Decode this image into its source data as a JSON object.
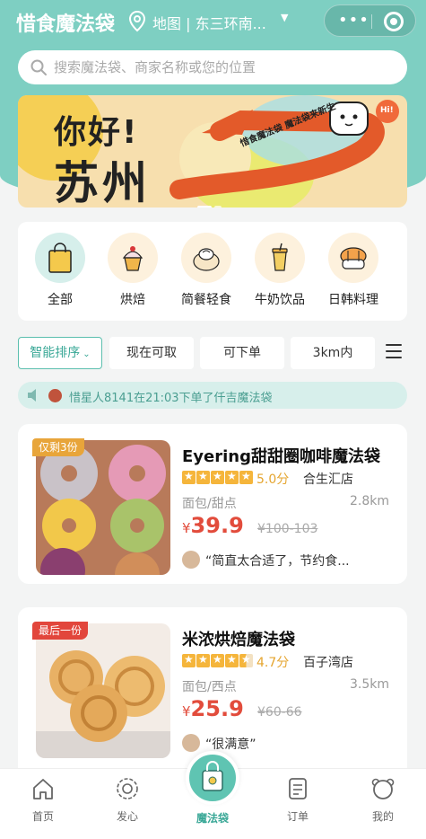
{
  "header": {
    "app_title": "惜食魔法袋",
    "location": "地图 | 东三环南...",
    "location_caret": "▼",
    "capsule_dots": "•••"
  },
  "search": {
    "placeholder": "搜索魔法袋、商家名称或您的位置"
  },
  "banner": {
    "hello": "你好!",
    "city": "苏州",
    "slogan": "惜食魔法袋  魔法袋来新生",
    "badge": "Hi!"
  },
  "categories": [
    {
      "label": "全部",
      "icon": "shopping-bag-icon"
    },
    {
      "label": "烘焙",
      "icon": "cupcake-icon"
    },
    {
      "label": "简餐轻食",
      "icon": "dumpling-icon"
    },
    {
      "label": "牛奶饮品",
      "icon": "drink-cup-icon"
    },
    {
      "label": "日韩料理",
      "icon": "sushi-icon"
    }
  ],
  "filters": {
    "sort": "智能排序",
    "sort_caret": "⌄",
    "available_now": "现在可取",
    "can_order": "可下单",
    "distance": "3km内"
  },
  "ticker": {
    "text": "惜星人8141在21:03下单了仟吉魔法袋"
  },
  "stores": [
    {
      "badge": "仅剩3份",
      "badge_color": "#e8a53a",
      "name": "Eyering甜甜圈咖啡魔法袋",
      "rating": 5.0,
      "score": "5.0分",
      "district": "合生汇店",
      "category": "面包/甜点",
      "distance": "2.8km",
      "currency": "¥",
      "price": "39.9",
      "original_price": "¥100-103",
      "review": "“简直太合适了，节约食..."
    },
    {
      "badge": "最后一份",
      "badge_color": "#e2463c",
      "name": "米浓烘焙魔法袋",
      "rating": 4.7,
      "score": "4.7分",
      "district": "百子湾店",
      "category": "面包/西点",
      "distance": "3.5km",
      "currency": "¥",
      "price": "25.9",
      "original_price": "¥60-66",
      "review": "“很满意”"
    }
  ],
  "tabbar": [
    {
      "label": "首页",
      "icon": "home-icon"
    },
    {
      "label": "发心",
      "icon": "sunflower-icon"
    },
    {
      "label": "魔法袋",
      "icon": "magic-bag-icon"
    },
    {
      "label": "订单",
      "icon": "order-list-icon"
    },
    {
      "label": "我的",
      "icon": "bear-face-icon"
    }
  ],
  "colors": {
    "brand": "#7ecfc2",
    "accent": "#3aa897",
    "price": "#e24c3c",
    "star": "#f5b53b"
  }
}
